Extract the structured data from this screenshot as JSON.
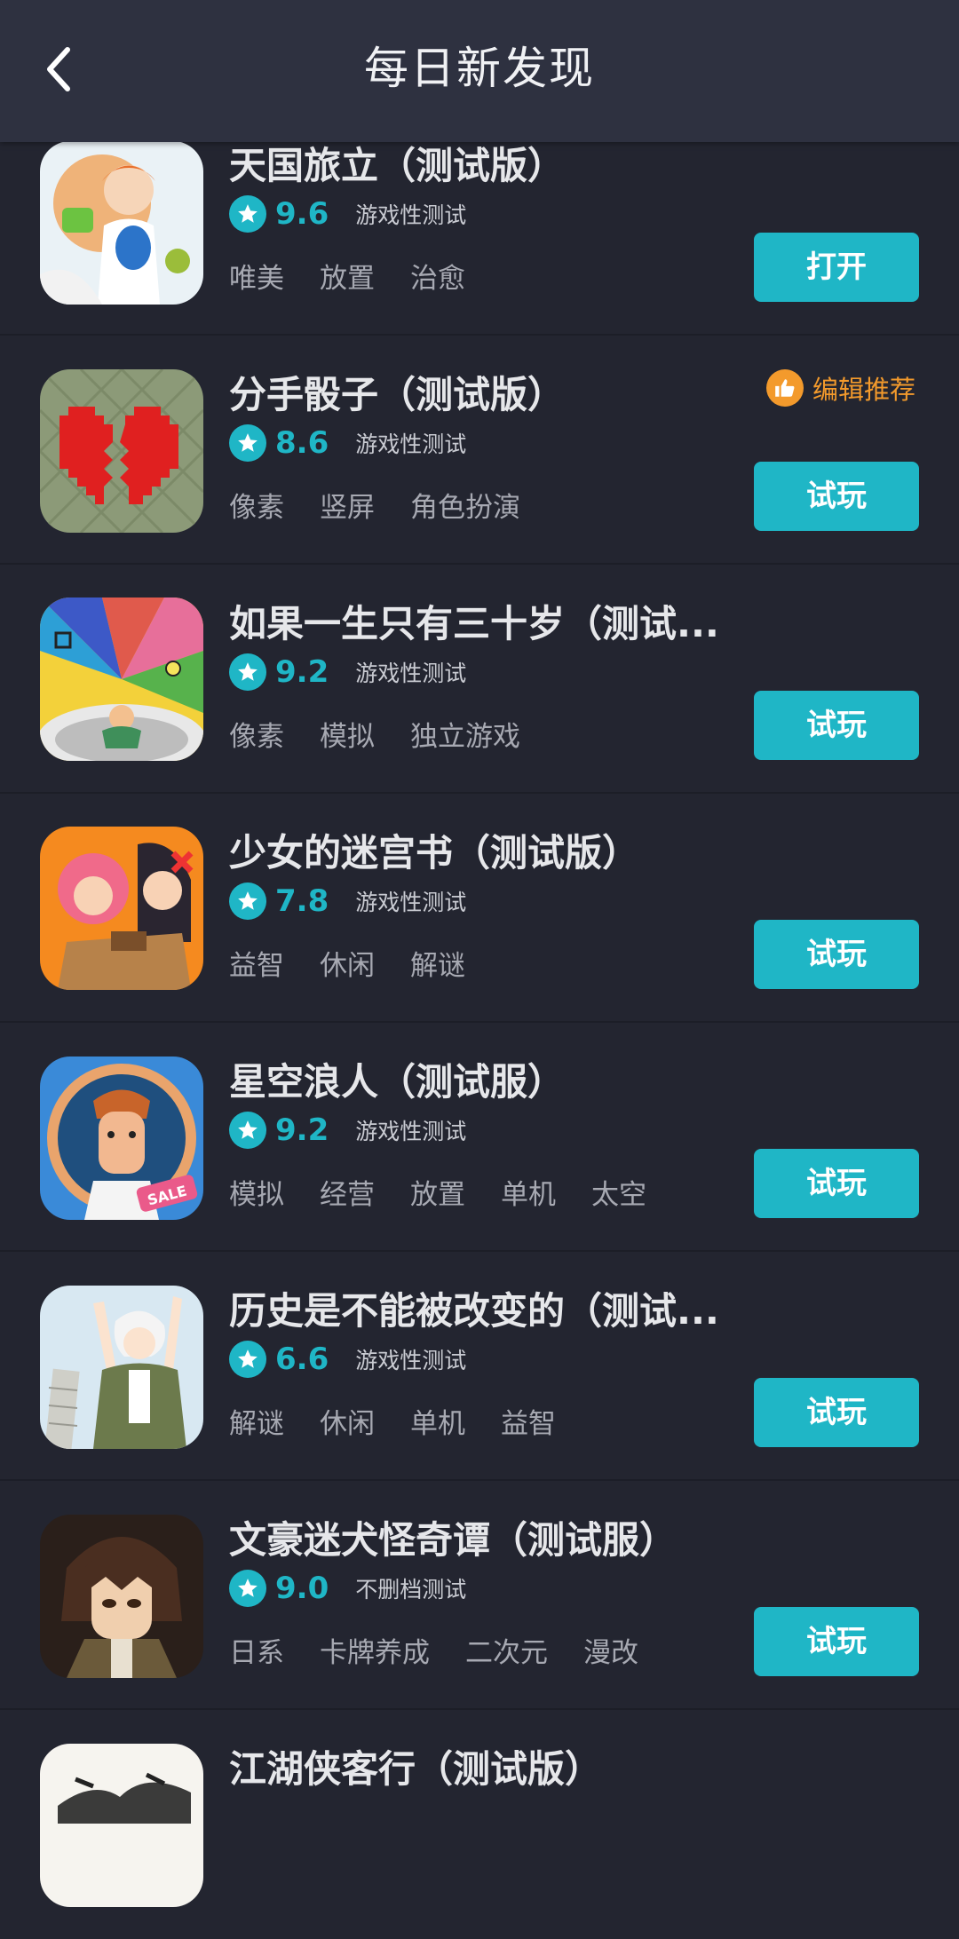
{
  "header": {
    "title": "每日新发现"
  },
  "colors": {
    "accent": "#1fb6c6",
    "background": "#232530",
    "header": "#2e3140",
    "recommend": "#f39a2c"
  },
  "games": [
    {
      "title": "天国旅立（测试版）",
      "score": "9.6",
      "status": "游戏性测试",
      "tags": [
        "唯美",
        "放置",
        "治愈"
      ],
      "action": "打开",
      "icon": "anime-girl-icon"
    },
    {
      "title": "分手骰子（测试版）",
      "score": "8.6",
      "status": "游戏性测试",
      "tags": [
        "像素",
        "竖屏",
        "角色扮演"
      ],
      "action": "试玩",
      "icon": "broken-heart-icon",
      "recommend": "编辑推荐"
    },
    {
      "title": "如果一生只有三十岁（测试...",
      "score": "9.2",
      "status": "游戏性测试",
      "tags": [
        "像素",
        "模拟",
        "独立游戏"
      ],
      "action": "试玩",
      "icon": "pixel-life-icon"
    },
    {
      "title": "少女的迷宫书（测试版）",
      "score": "7.8",
      "status": "游戏性测试",
      "tags": [
        "益智",
        "休闲",
        "解谜"
      ],
      "action": "试玩",
      "icon": "maze-girls-icon"
    },
    {
      "title": "星空浪人（测试服）",
      "score": "9.2",
      "status": "游戏性测试",
      "tags": [
        "模拟",
        "经营",
        "放置",
        "单机",
        "太空"
      ],
      "action": "试玩",
      "icon": "astronaut-sale-icon"
    },
    {
      "title": "历史是不能被改变的（测试...",
      "score": "6.6",
      "status": "游戏性测试",
      "tags": [
        "解谜",
        "休闲",
        "单机",
        "益智"
      ],
      "action": "试玩",
      "icon": "history-boy-icon"
    },
    {
      "title": "文豪迷犬怪奇谭（测试服）",
      "score": "9.0",
      "status": "不删档测试",
      "tags": [
        "日系",
        "卡牌养成",
        "二次元",
        "漫改"
      ],
      "action": "试玩",
      "icon": "dazai-icon"
    },
    {
      "title": "江湖侠客行（测试版）",
      "icon": "ink-wash-icon"
    }
  ]
}
